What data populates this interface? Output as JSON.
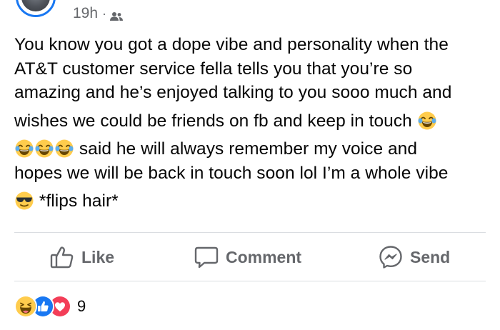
{
  "post": {
    "timestamp": "19h",
    "separator": "·",
    "privacy_icon": "friends-icon",
    "text_segments": {
      "line1": "You know you got a dope vibe and personality when the",
      "line2": "AT&T customer service fella tells you that you’re so",
      "line3": "amazing and he’s enjoyed talking to you sooo much and",
      "line4": "wishes we could be friends on fb and keep in touch",
      "line5": "said he will always remember my voice and",
      "line6": "hopes we will be back in touch soon lol I’m a whole vibe",
      "line7": "*flips hair*"
    },
    "emojis": {
      "laughing": "tears-of-joy-emoji",
      "cool": "sunglasses-emoji"
    }
  },
  "actions": {
    "like_label": "Like",
    "comment_label": "Comment",
    "send_label": "Send"
  },
  "reactions": {
    "icons": [
      "haha-reaction-icon",
      "like-reaction-icon",
      "love-reaction-icon"
    ],
    "count": "9"
  },
  "colors": {
    "accent": "#1877f2",
    "secondary_text": "#65676b",
    "divider": "#dadde1",
    "love": "#f33e58",
    "emoji_yellow": "#ffcc4d"
  }
}
